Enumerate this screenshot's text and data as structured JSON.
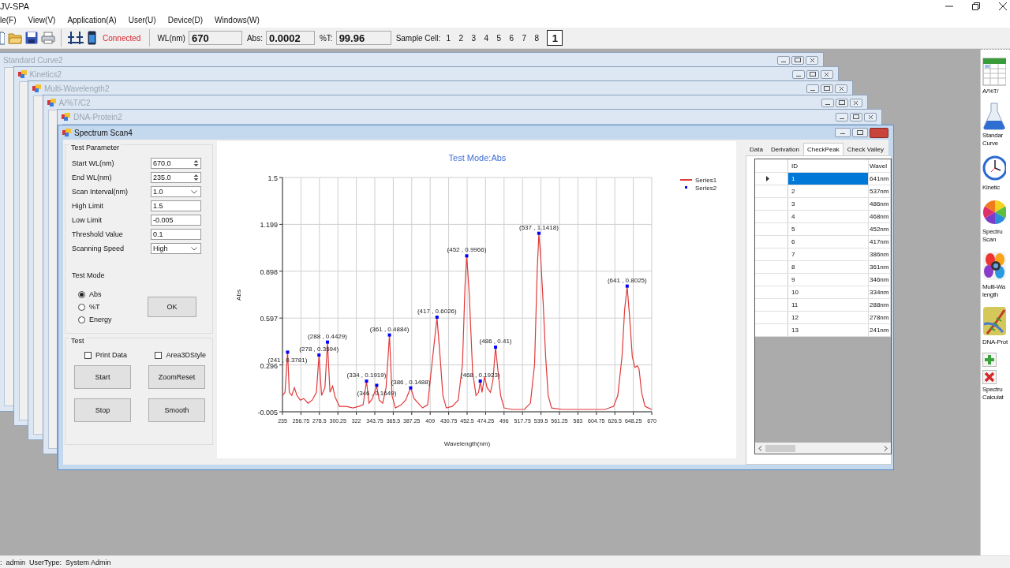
{
  "app": {
    "title": "JV-SPA"
  },
  "menu": [
    "le(F)",
    "View(V)",
    "Application(A)",
    "User(U)",
    "Device(D)",
    "Windows(W)"
  ],
  "toolbar": {
    "status": "Connected",
    "wl_label": "WL(nm)",
    "wl": "670",
    "abs_label": "Abs:",
    "abs": "0.0002",
    "t_label": "%T:",
    "t": "99.96",
    "cell_label": "Sample Cell:",
    "cells": [
      "1",
      "2",
      "3",
      "4",
      "5",
      "6",
      "7",
      "8"
    ],
    "current_cell": "1"
  },
  "background_windows": [
    {
      "title": "Standard Curve2"
    },
    {
      "title": "Kinetics2"
    },
    {
      "title": "Multi-Wavelength2"
    },
    {
      "title": "A/%T/C2"
    },
    {
      "title": "DNA-Protein2"
    }
  ],
  "window": {
    "title": "Spectrum Scan4",
    "parameters_group": "Test Parameter",
    "parameters": [
      {
        "kind": "spin",
        "label": "Start WL(nm)",
        "value": "670.0"
      },
      {
        "kind": "spin",
        "label": "End WL(nm)",
        "value": "235.0"
      },
      {
        "kind": "combo",
        "label": "Scan Interval(nm)",
        "value": "1.0"
      },
      {
        "kind": "text",
        "label": "High Limit",
        "value": "1.5"
      },
      {
        "kind": "text",
        "label": "Low Limit",
        "value": "-0.005"
      },
      {
        "kind": "text",
        "label": "Threshold Value",
        "value": "0.1"
      },
      {
        "kind": "combo",
        "label": "Scanning Speed",
        "value": "High"
      }
    ],
    "test_mode_label": "Test Mode",
    "modes": [
      {
        "label": "Abs",
        "selected": true
      },
      {
        "label": "%T",
        "selected": false
      },
      {
        "label": "Energy",
        "selected": false
      }
    ],
    "ok": "OK",
    "test_group": "Test",
    "checks": [
      {
        "label": "Print Data",
        "checked": false
      },
      {
        "label": "Area3DStyle",
        "checked": false
      }
    ],
    "buttons": [
      "Start",
      "ZoomReset",
      "Stop",
      "Smooth"
    ],
    "chart": {
      "chart_data": {
        "type": "line",
        "title": "Test Mode:Abs",
        "xlabel": "Wavelength(nm)",
        "ylabel": "Abs",
        "xlim": [
          235,
          670
        ],
        "ylim": [
          -0.005,
          1.5
        ],
        "xticks": [
          235,
          256.75,
          278.5,
          300.25,
          322,
          343.75,
          365.5,
          387.25,
          409,
          430.75,
          452.5,
          474.25,
          496,
          517.75,
          539.5,
          561.25,
          583,
          604.75,
          626.5,
          648.25,
          670
        ],
        "yticks": [
          -0.005,
          0.296,
          0.597,
          0.898,
          1.199,
          1.5
        ],
        "x": [
          235,
          238,
          241,
          243,
          246,
          249,
          252,
          256,
          260,
          265,
          270,
          275,
          278,
          281,
          285,
          288,
          291,
          294,
          297,
          302,
          310,
          318,
          325,
          330,
          334,
          337,
          341,
          346,
          349,
          353,
          357,
          361,
          364,
          368,
          375,
          380,
          386,
          390,
          395,
          400,
          406,
          410,
          414,
          417,
          420,
          424,
          428,
          435,
          442,
          447,
          450,
          452,
          455,
          459,
          463,
          466,
          468,
          470,
          473,
          476,
          480,
          483,
          486,
          489,
          492,
          496,
          505,
          520,
          527,
          532,
          535,
          537,
          539,
          542,
          545,
          548,
          552,
          565,
          590,
          615,
          625,
          630,
          635,
          638,
          641,
          644,
          647,
          650,
          653,
          655,
          658,
          662,
          666,
          670
        ],
        "grid": true,
        "series": [
          {
            "name": "Series1",
            "color": "#e03a3a",
            "values": [
              0.1,
              0.12,
              0.38,
              0.12,
              0.1,
              0.15,
              0.1,
              0.07,
              0.08,
              0.05,
              0.07,
              0.12,
              0.36,
              0.1,
              0.15,
              0.44,
              0.12,
              0.16,
              0.09,
              0.03,
              0.03,
              0.02,
              0.03,
              0.04,
              0.19,
              0.05,
              0.08,
              0.16,
              0.07,
              0.05,
              0.15,
              0.49,
              0.1,
              0.02,
              0.04,
              0.07,
              0.15,
              0.08,
              0.05,
              0.02,
              0.04,
              0.25,
              0.45,
              0.6,
              0.4,
              0.1,
              0.02,
              0.03,
              0.07,
              0.3,
              0.8,
              1.0,
              0.75,
              0.25,
              0.1,
              0.12,
              0.19,
              0.12,
              0.22,
              0.15,
              0.12,
              0.2,
              0.41,
              0.25,
              0.1,
              0.02,
              0.01,
              0.01,
              0.05,
              0.3,
              0.9,
              1.14,
              1.0,
              0.7,
              0.35,
              0.1,
              0.02,
              0.01,
              0.01,
              0.01,
              0.03,
              0.1,
              0.35,
              0.65,
              0.8,
              0.6,
              0.35,
              0.28,
              0.29,
              0.27,
              0.12,
              0.03,
              0.02,
              0.01
            ]
          }
        ],
        "annotations": [
          {
            "x": 241,
            "y": 0.3781,
            "text": "(241 , 0.3781)"
          },
          {
            "x": 278,
            "y": 0.3594,
            "text": "(278 , 0.3594)"
          },
          {
            "x": 288,
            "y": 0.4429,
            "text": "(288 , 0.4429)"
          },
          {
            "x": 334,
            "y": 0.1919,
            "text": "(334 , 0.1919)"
          },
          {
            "x": 346,
            "y": 0.1649,
            "text": "(346 , 0.1649)"
          },
          {
            "x": 361,
            "y": 0.4884,
            "text": "(361 , 0.4884)"
          },
          {
            "x": 386,
            "y": 0.1488,
            "text": "(386 , 0.1488)"
          },
          {
            "x": 417,
            "y": 0.6026,
            "text": "(417 , 0.6026)"
          },
          {
            "x": 452,
            "y": 0.9966,
            "text": "(452 , 0.9966)"
          },
          {
            "x": 468,
            "y": 0.1923,
            "text": "(468 , 0.1923)"
          },
          {
            "x": 486,
            "y": 0.41,
            "text": "(486 , 0.41)"
          },
          {
            "x": 537,
            "y": 1.1418,
            "text": "(537 , 1.1418)"
          },
          {
            "x": 641,
            "y": 0.8025,
            "text": "(641 , 0.8025)"
          }
        ]
      },
      "peak_legend": {
        "name": "Series2",
        "color": "#0000ff"
      }
    },
    "tabs": [
      {
        "label": "Data",
        "selected": false
      },
      {
        "label": "Derivation",
        "selected": false
      },
      {
        "label": "CheckPeak",
        "selected": true
      },
      {
        "label": "Check Valley",
        "selected": false
      }
    ],
    "grid": {
      "columns": [
        "ID",
        "Wavel"
      ],
      "rows": [
        {
          "id": "1",
          "wavelength": "641nm",
          "selected": true
        },
        {
          "id": "2",
          "wavelength": "537nm",
          "selected": false
        },
        {
          "id": "3",
          "wavelength": "486nm",
          "selected": false
        },
        {
          "id": "4",
          "wavelength": "468nm",
          "selected": false
        },
        {
          "id": "5",
          "wavelength": "452nm",
          "selected": false
        },
        {
          "id": "6",
          "wavelength": "417nm",
          "selected": false
        },
        {
          "id": "7",
          "wavelength": "386nm",
          "selected": false
        },
        {
          "id": "8",
          "wavelength": "361nm",
          "selected": false
        },
        {
          "id": "9",
          "wavelength": "346nm",
          "selected": false
        },
        {
          "id": "10",
          "wavelength": "334nm",
          "selected": false
        },
        {
          "id": "11",
          "wavelength": "288nm",
          "selected": false
        },
        {
          "id": "12",
          "wavelength": "278nm",
          "selected": false
        },
        {
          "id": "13",
          "wavelength": "241nm",
          "selected": false
        }
      ]
    }
  },
  "sidebar": {
    "items": [
      {
        "kind": "sheet",
        "label": [
          "A/%T/"
        ]
      },
      {
        "kind": "flask",
        "label": [
          "Standar",
          "Curve"
        ]
      },
      {
        "kind": "clock",
        "label": [
          "Kinetic"
        ]
      },
      {
        "kind": "wheel",
        "label": [
          "Spectru",
          "Scan"
        ]
      },
      {
        "kind": "petals",
        "label": [
          "Multi-Wa",
          "length"
        ]
      },
      {
        "kind": "dna",
        "label": [
          "DNA-Prot"
        ]
      },
      {
        "kind": "tools",
        "label": [
          "Spectru",
          "Calculat"
        ]
      }
    ]
  },
  "status_bar": {
    "texts": [
      ":",
      "admin",
      "UserType:",
      "System Admin"
    ]
  }
}
